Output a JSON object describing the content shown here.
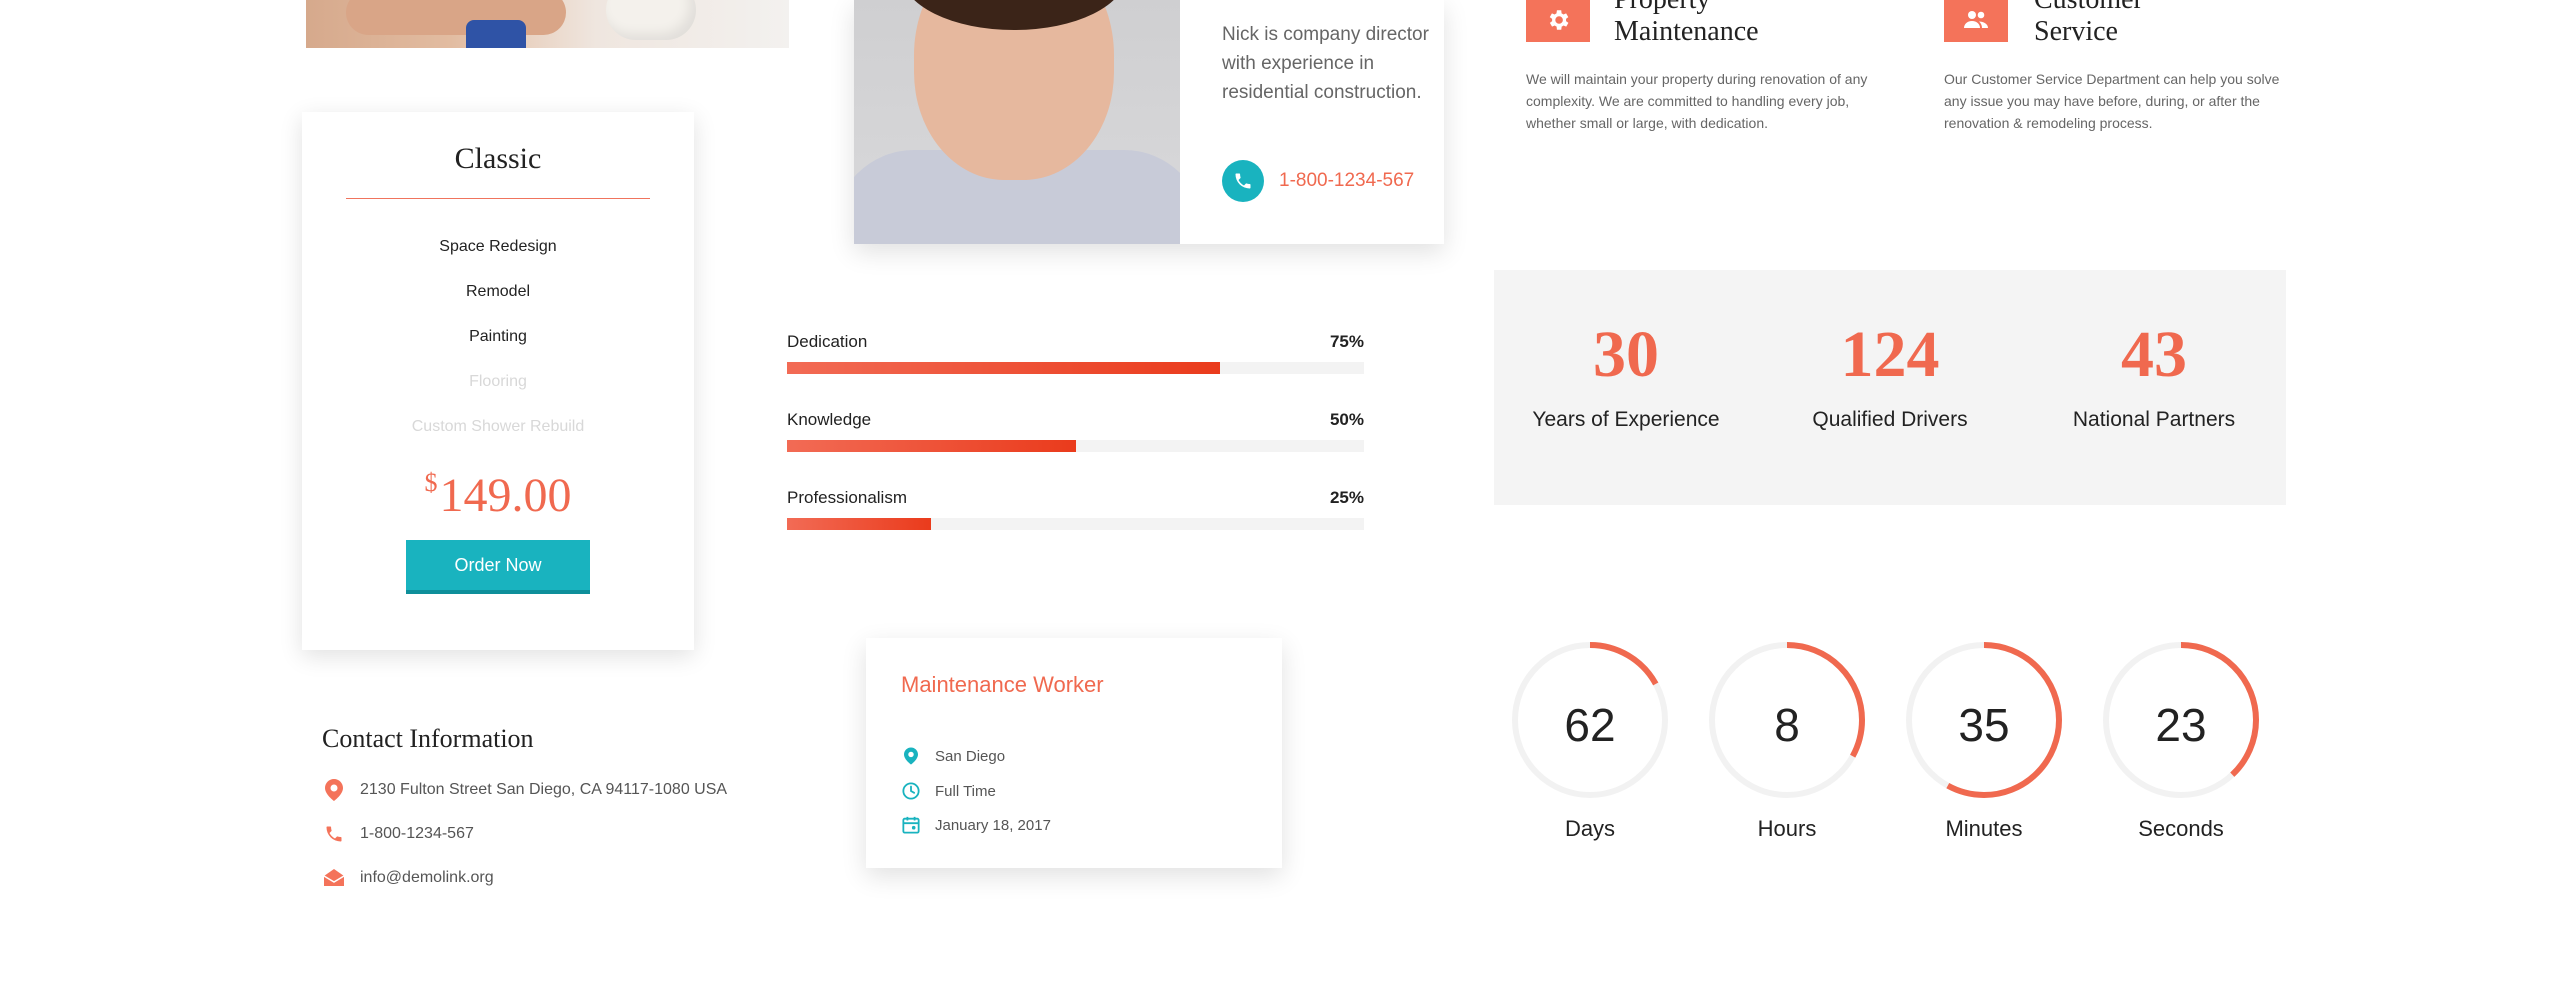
{
  "pricing": {
    "title": "Classic",
    "features": [
      {
        "label": "Space Redesign",
        "enabled": true
      },
      {
        "label": "Remodel",
        "enabled": true
      },
      {
        "label": "Painting",
        "enabled": true
      },
      {
        "label": "Flooring",
        "enabled": false
      },
      {
        "label": "Custom Shower Rebuild",
        "enabled": false
      }
    ],
    "currency": "$",
    "price": "149.00",
    "order_button": "Order Now"
  },
  "contact": {
    "title": "Contact Information",
    "address": "2130 Fulton Street San Diego, CA 94117-1080 USA",
    "phone": "1-800-1234-567",
    "email": "info@demolink.org"
  },
  "team": {
    "bio": "Nick is company director with experience in residential construction.",
    "phone": "1-800-1234-567"
  },
  "skills": [
    {
      "label": "Dedication",
      "percent_text": "75%",
      "value": 75
    },
    {
      "label": "Knowledge",
      "percent_text": "50%",
      "value": 50
    },
    {
      "label": "Professionalism",
      "percent_text": "25%",
      "value": 25
    }
  ],
  "job": {
    "title": "Maintenance Worker",
    "location": "San Diego",
    "type": "Full Time",
    "date": "January 18, 2017"
  },
  "services": [
    {
      "title_line1": "Property",
      "title_line2": "Maintenance",
      "text": "We will maintain your property during renovation of any complexity. We are committed to handling every job, whether small or large, with dedication.",
      "icon": "gear-icon"
    },
    {
      "title_line1": "Customer",
      "title_line2": "Service",
      "text": "Our Customer Service Department can help you solve any issue you may have before, during, or after the renovation & remodeling process.",
      "icon": "users-icon"
    }
  ],
  "stats": [
    {
      "number": "30",
      "label": "Years of Experience"
    },
    {
      "number": "124",
      "label": "Qualified Drivers"
    },
    {
      "number": "43",
      "label": "National Partners"
    }
  ],
  "countdown": [
    {
      "value": "62",
      "unit": "Days",
      "fraction": 0.17
    },
    {
      "value": "8",
      "unit": "Hours",
      "fraction": 0.33
    },
    {
      "value": "35",
      "unit": "Minutes",
      "fraction": 0.58
    },
    {
      "value": "23",
      "unit": "Seconds",
      "fraction": 0.38
    }
  ],
  "colors": {
    "accent": "#f0694f",
    "teal": "#19b3bf",
    "ring_track": "#f2f2f2"
  }
}
